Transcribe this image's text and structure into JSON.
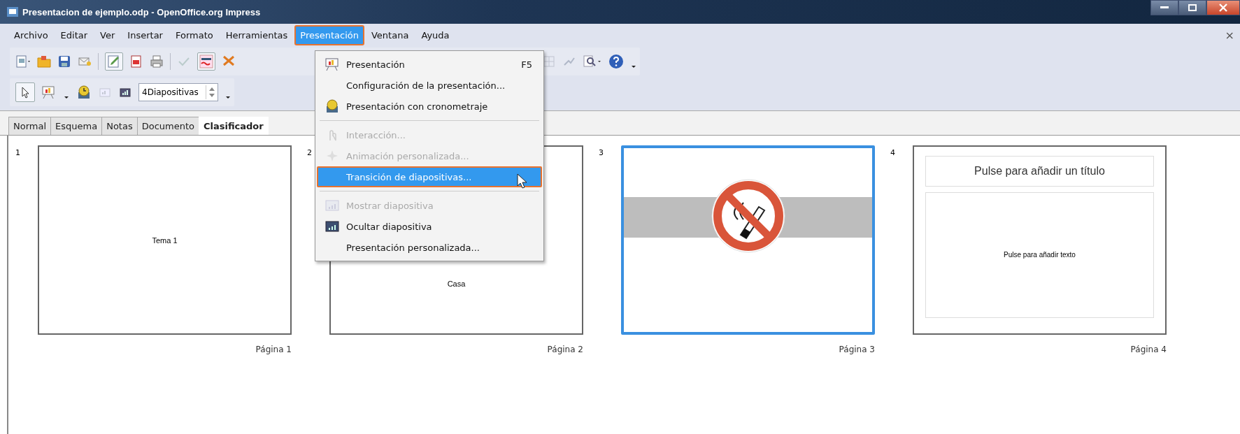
{
  "window": {
    "title": "Presentacion de ejemplo.odp - OpenOffice.org Impress"
  },
  "menu_bar": {
    "items": [
      {
        "label": "Archivo",
        "selected": false
      },
      {
        "label": "Editar",
        "selected": false
      },
      {
        "label": "Ver",
        "selected": false
      },
      {
        "label": "Insertar",
        "selected": false
      },
      {
        "label": "Formato",
        "selected": false
      },
      {
        "label": "Herramientas",
        "selected": false
      },
      {
        "label": "Presentación",
        "selected": true
      },
      {
        "label": "Ventana",
        "selected": false
      },
      {
        "label": "Ayuda",
        "selected": false
      }
    ],
    "close": "×"
  },
  "toolbar": {
    "slides_field": "4Diapositivas"
  },
  "view_tabs": [
    {
      "label": "Normal",
      "selected": false
    },
    {
      "label": "Esquema",
      "selected": false
    },
    {
      "label": "Notas",
      "selected": false
    },
    {
      "label": "Documento",
      "selected": false
    },
    {
      "label": "Clasificador",
      "selected": true
    }
  ],
  "dropdown_menu": {
    "items": [
      {
        "kind": "item",
        "label": "Presentación",
        "shortcut": "F5",
        "disabled": false,
        "selected": false
      },
      {
        "kind": "item",
        "label": "Configuración de la presentación...",
        "disabled": false,
        "selected": false
      },
      {
        "kind": "item",
        "label": "Presentación con cronometraje",
        "disabled": false,
        "selected": false
      },
      {
        "kind": "separator"
      },
      {
        "kind": "item",
        "label": "Interacción...",
        "disabled": true,
        "selected": false
      },
      {
        "kind": "item",
        "label": "Animación personalizada...",
        "disabled": true,
        "selected": false
      },
      {
        "kind": "item",
        "label": "Transición de diapositivas...",
        "disabled": false,
        "selected": true
      },
      {
        "kind": "separator"
      },
      {
        "kind": "item",
        "label": "Mostrar diapositiva",
        "disabled": true,
        "selected": false
      },
      {
        "kind": "item",
        "label": "Ocultar diapositiva",
        "disabled": false,
        "selected": false
      },
      {
        "kind": "item",
        "label": "Presentación personalizada...",
        "disabled": false,
        "selected": false
      }
    ]
  },
  "slides": [
    {
      "number": "1",
      "kind": "title",
      "text": "Tema 1",
      "page_label": "Página 1",
      "selected": false
    },
    {
      "number": "2",
      "kind": "title",
      "text": "Casa",
      "page_label": "Página 2",
      "selected": false
    },
    {
      "number": "3",
      "kind": "sign",
      "page_label": "Página 3",
      "selected": true
    },
    {
      "number": "4",
      "kind": "placeholder",
      "title": "Pulse para añadir un título",
      "text": "Pulse para añadir texto",
      "page_label": "Página 4",
      "selected": false
    }
  ]
}
